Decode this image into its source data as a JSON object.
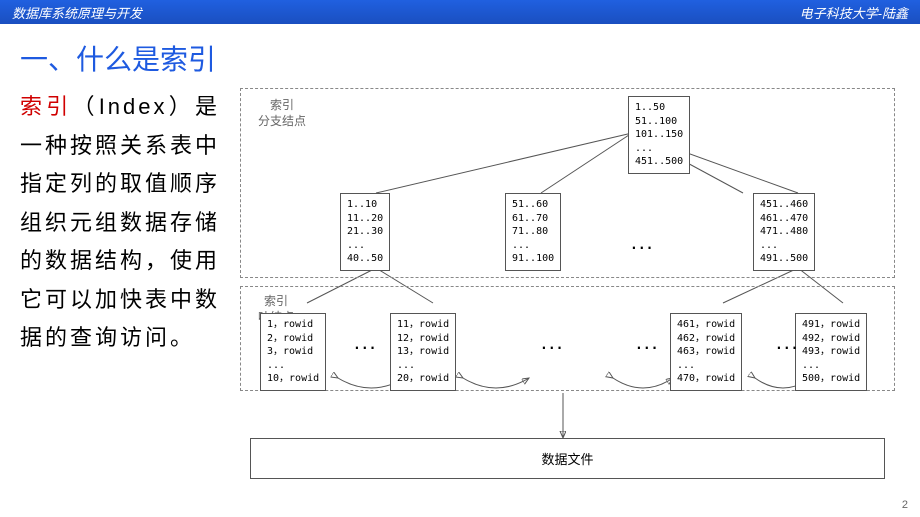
{
  "header": {
    "left": "数据库系统原理与开发",
    "right": "电子科技大学-陆鑫"
  },
  "title": "一、什么是索引",
  "desc": {
    "red": "索引",
    "rest": "（Index）是一种按照关系表中指定列的取值顺序组织元组数据存储的数据结构，使用它可以加快表中数据的查询访问。"
  },
  "labels": {
    "branch": "索引\n分支结点",
    "leaf": "索引\n叶结点"
  },
  "root": "1..50\n51..100\n101..150\n...\n451..500",
  "branch": {
    "b1": "1..10\n11..20\n21..30\n...\n40..50",
    "b2": "51..60\n61..70\n71..80\n...\n91..100",
    "b3": "451..460\n461..470\n471..480\n...\n491..500"
  },
  "leaf": {
    "l1": "1，rowid\n2，rowid\n3，rowid\n...\n10，rowid",
    "l2": "11，rowid\n12，rowid\n13，rowid\n...\n20，rowid",
    "l3": "461，rowid\n462，rowid\n463，rowid\n...\n470，rowid",
    "l4": "491，rowid\n492，rowid\n493，rowid\n...\n500，rowid"
  },
  "datafile": "数据文件",
  "dots": "...",
  "page": "2"
}
